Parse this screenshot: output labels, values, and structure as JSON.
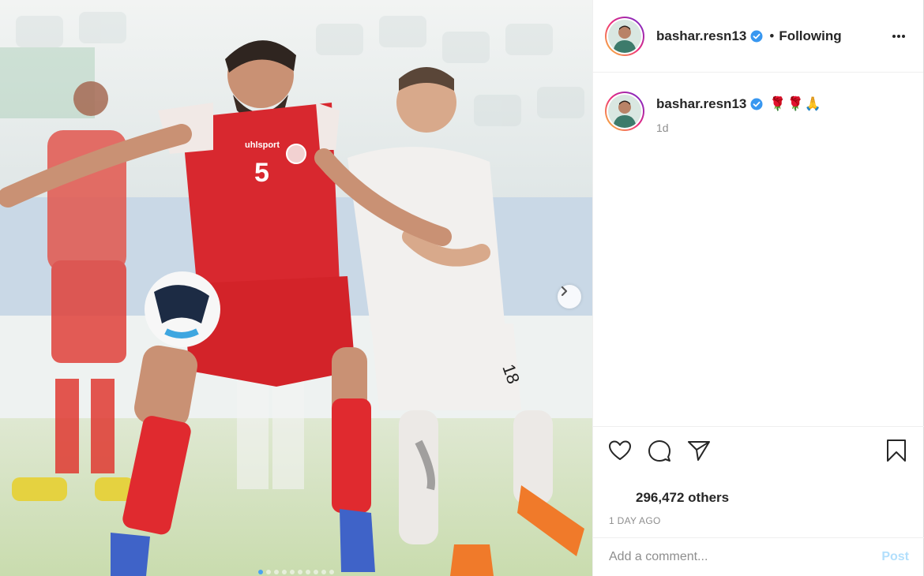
{
  "post": {
    "username": "bashar.resn13",
    "follow_state": "Following",
    "separator": "•",
    "caption_emojis": "🌹🌹🙏",
    "caption_time": "1d",
    "likes_text": "296,472 others",
    "time_ago": "1 DAY AGO",
    "comment_placeholder": "Add a comment...",
    "post_label": "Post"
  },
  "media": {
    "jersey_left_number": "5",
    "jersey_right_number": "18",
    "sponsor_text": "uhlsport",
    "carousel_total": 10,
    "carousel_active_index": 0
  },
  "colors": {
    "red_kit": "#d8282f",
    "white_kit": "#f2f0ee",
    "verified_blue": "#3897f0",
    "post_button": "#b2dffc"
  },
  "icons": [
    "more-options-icon",
    "verified-badge-icon",
    "heart-icon",
    "comment-icon",
    "share-icon",
    "bookmark-icon",
    "next-arrow-icon"
  ]
}
